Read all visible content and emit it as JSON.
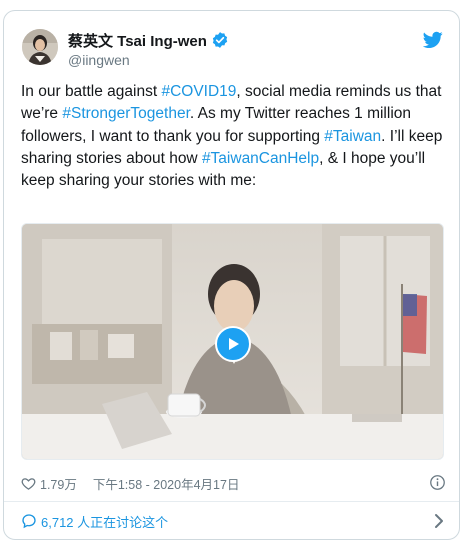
{
  "colors": {
    "link": "#1b95e0",
    "muted": "#697882",
    "border": "#cfd9de",
    "brand": "#1da1f2"
  },
  "author": {
    "display_name": "蔡英文 Tsai Ing-wen",
    "handle": "@iingwen",
    "verified": true
  },
  "tweet": {
    "segments": [
      {
        "text": "In our battle against ",
        "hashtag": false
      },
      {
        "text": "#COVID19",
        "hashtag": true
      },
      {
        "text": ", social media reminds us that we’re ",
        "hashtag": false
      },
      {
        "text": "#StrongerTogether",
        "hashtag": true
      },
      {
        "text": ". As my Twitter reaches 1 million followers, I want to thank you for supporting ",
        "hashtag": false
      },
      {
        "text": "#Taiwan",
        "hashtag": true
      },
      {
        "text": ". I’ll keep sharing stories about how ",
        "hashtag": false
      },
      {
        "text": "#TaiwanCanHelp",
        "hashtag": true
      },
      {
        "text": ", & I hope you’ll keep sharing your stories with me:",
        "hashtag": false
      }
    ]
  },
  "media": {
    "type": "video",
    "play_icon": "play-icon"
  },
  "footer": {
    "likes": "1.79万",
    "timestamp": "下午1:58 - 2020年4月17日",
    "conversation": "6,712 人正在讨论这个"
  },
  "icons": [
    "twitter-bird-icon",
    "verified-badge-icon",
    "heart-icon",
    "info-icon",
    "comment-bubble-icon",
    "chevron-right-icon"
  ]
}
